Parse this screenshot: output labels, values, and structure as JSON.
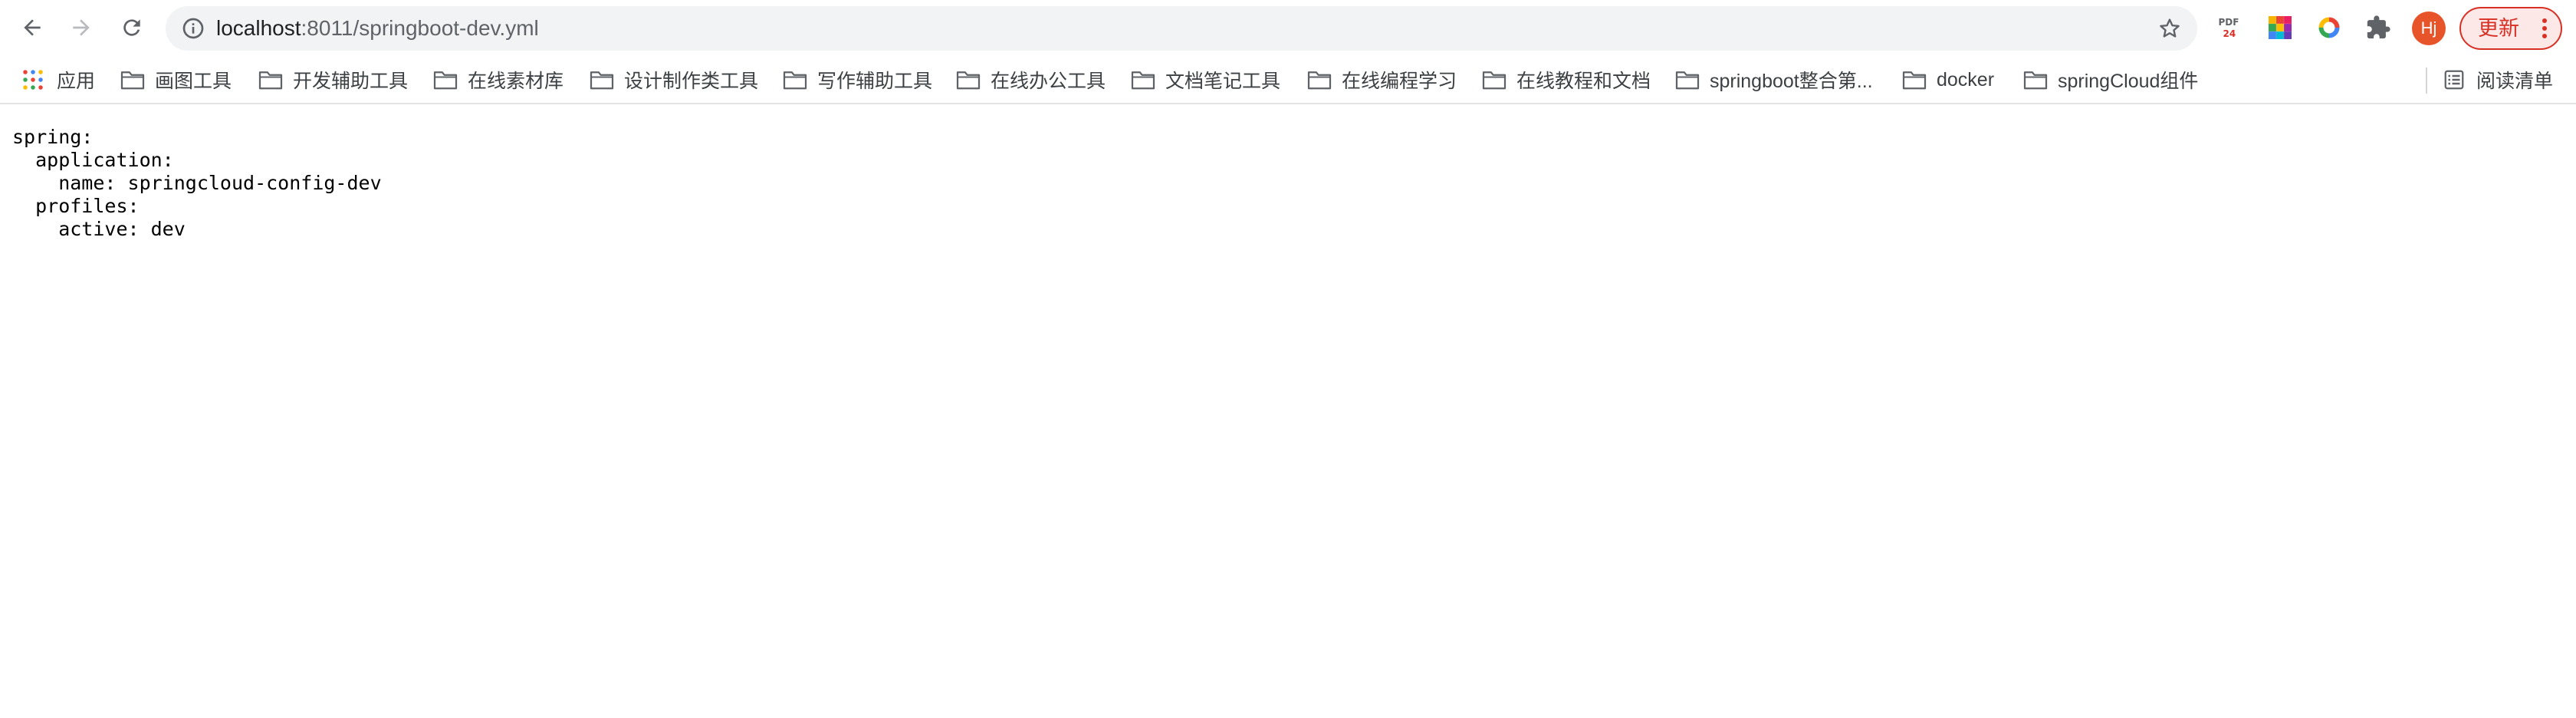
{
  "toolbar": {
    "url_host": "localhost",
    "url_path": ":8011/springboot-dev.yml",
    "avatar_initials": "Hj",
    "update_label": "更新",
    "extensions": [
      "pdf-tool-icon",
      "color-palette-icon",
      "colorful-ring-icon",
      "puzzle-icon"
    ]
  },
  "bookmarks": {
    "apps_label": "应用",
    "items": [
      {
        "label": "画图工具"
      },
      {
        "label": "开发辅助工具"
      },
      {
        "label": "在线素材库"
      },
      {
        "label": "设计制作类工具"
      },
      {
        "label": "写作辅助工具"
      },
      {
        "label": "在线办公工具"
      },
      {
        "label": "文档笔记工具"
      },
      {
        "label": "在线编程学习"
      },
      {
        "label": "在线教程和文档"
      },
      {
        "label": "springboot整合第..."
      },
      {
        "label": "docker"
      },
      {
        "label": "springCloud组件"
      }
    ],
    "reading_list_label": "阅读清单"
  },
  "document": {
    "lines": [
      "spring:",
      "  application:",
      "    name: springcloud-config-dev",
      "  profiles:",
      "    active: dev"
    ]
  },
  "colors": {
    "omnibox_bg": "#f1f3f4",
    "accent_red": "#d93025",
    "avatar_bg": "#e8542a"
  }
}
